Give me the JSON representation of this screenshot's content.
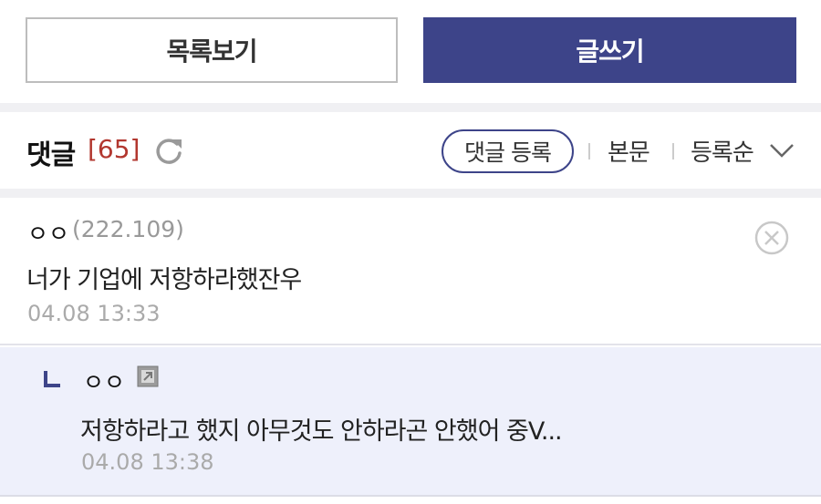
{
  "buttons": {
    "list_label": "목록보기",
    "write_label": "글쓰기"
  },
  "comments_header": {
    "title": "댓글",
    "count": "[65]",
    "register_label": "댓글 등록",
    "body_link": "본문",
    "sort_label": "등록순"
  },
  "comment": {
    "nickname": "ㅇㅇ",
    "ip": "(222.109)",
    "text": "너가 기업에 저항하라했잔우",
    "date": "04.08 13:33"
  },
  "reply": {
    "nickname": "ㅇㅇ",
    "text": "저항하라고 했지 아무것도 안하라곤 안했어 중V...",
    "date": "04.08 13:38"
  },
  "colors": {
    "accent": "#3d4489",
    "count_red": "#b2372f",
    "reply_bg": "#eef0fb"
  },
  "icons": [
    "refresh-icon",
    "chevron-down-icon",
    "delete-icon",
    "reply-arrow-icon",
    "fixed-nickname-icon"
  ]
}
